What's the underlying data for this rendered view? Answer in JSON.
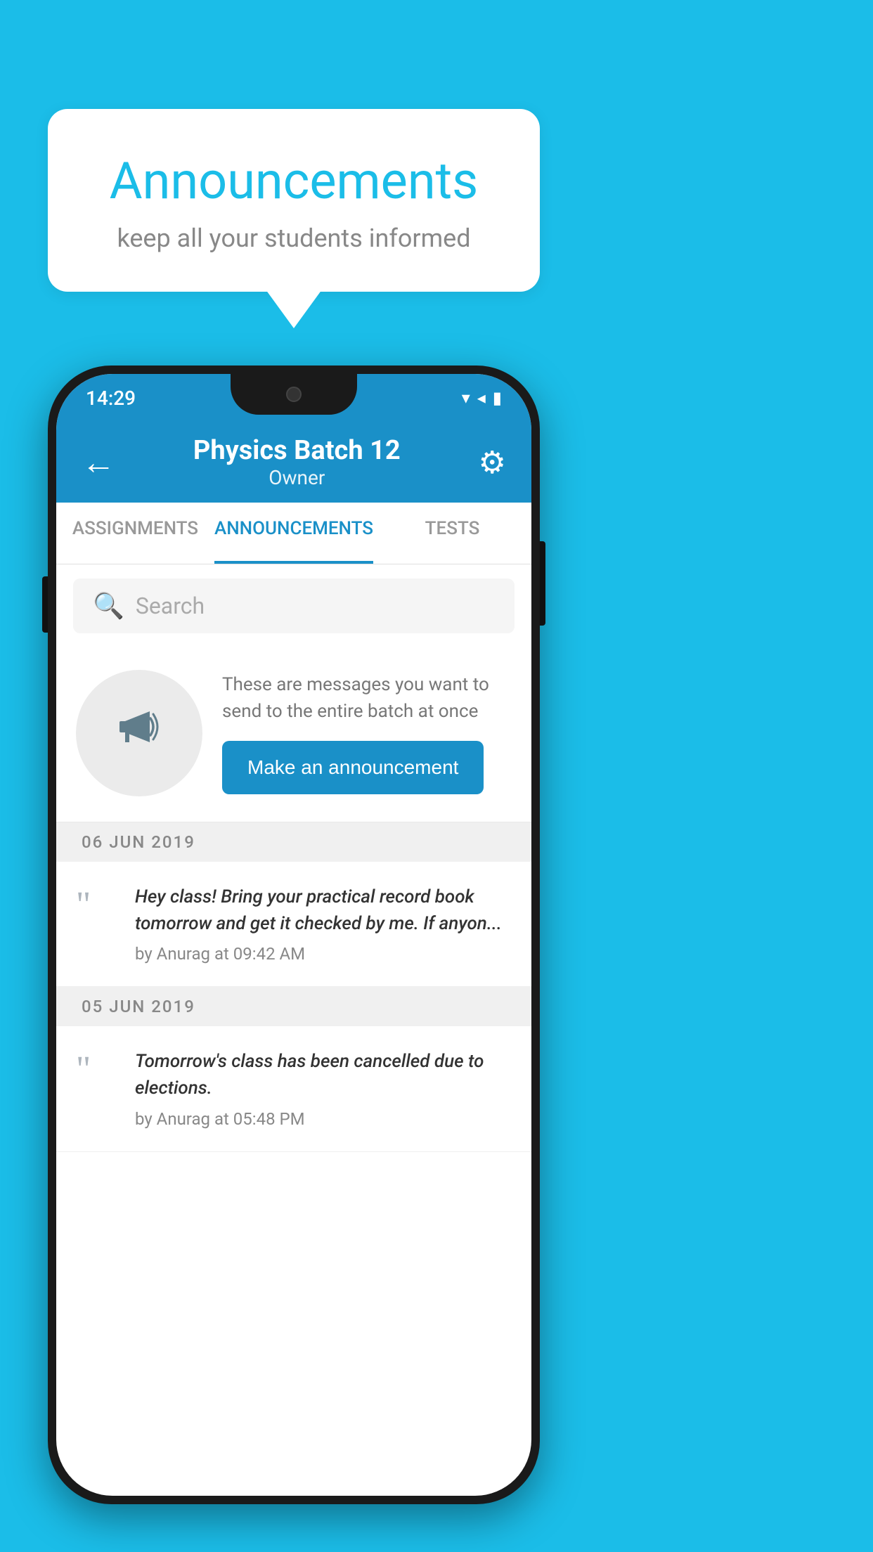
{
  "background_color": "#1bbde8",
  "speech_bubble": {
    "title": "Announcements",
    "subtitle": "keep all your students informed"
  },
  "phone": {
    "status_bar": {
      "time": "14:29",
      "icons": "▾◂▮"
    },
    "app_bar": {
      "back_label": "←",
      "title": "Physics Batch 12",
      "subtitle": "Owner",
      "gear_label": "⚙"
    },
    "tabs": [
      {
        "label": "ASSIGNMENTS",
        "active": false
      },
      {
        "label": "ANNOUNCEMENTS",
        "active": true
      },
      {
        "label": "TESTS",
        "active": false
      }
    ],
    "search": {
      "placeholder": "Search"
    },
    "promo": {
      "icon": "📣",
      "text": "These are messages you want to send to the entire batch at once",
      "button_label": "Make an announcement"
    },
    "announcements": [
      {
        "date": "06  JUN  2019",
        "text": "Hey class! Bring your practical record book tomorrow and get it checked by me. If anyon...",
        "meta": "by Anurag at 09:42 AM"
      },
      {
        "date": "05  JUN  2019",
        "text": "Tomorrow's class has been cancelled due to elections.",
        "meta": "by Anurag at 05:48 PM"
      }
    ]
  }
}
